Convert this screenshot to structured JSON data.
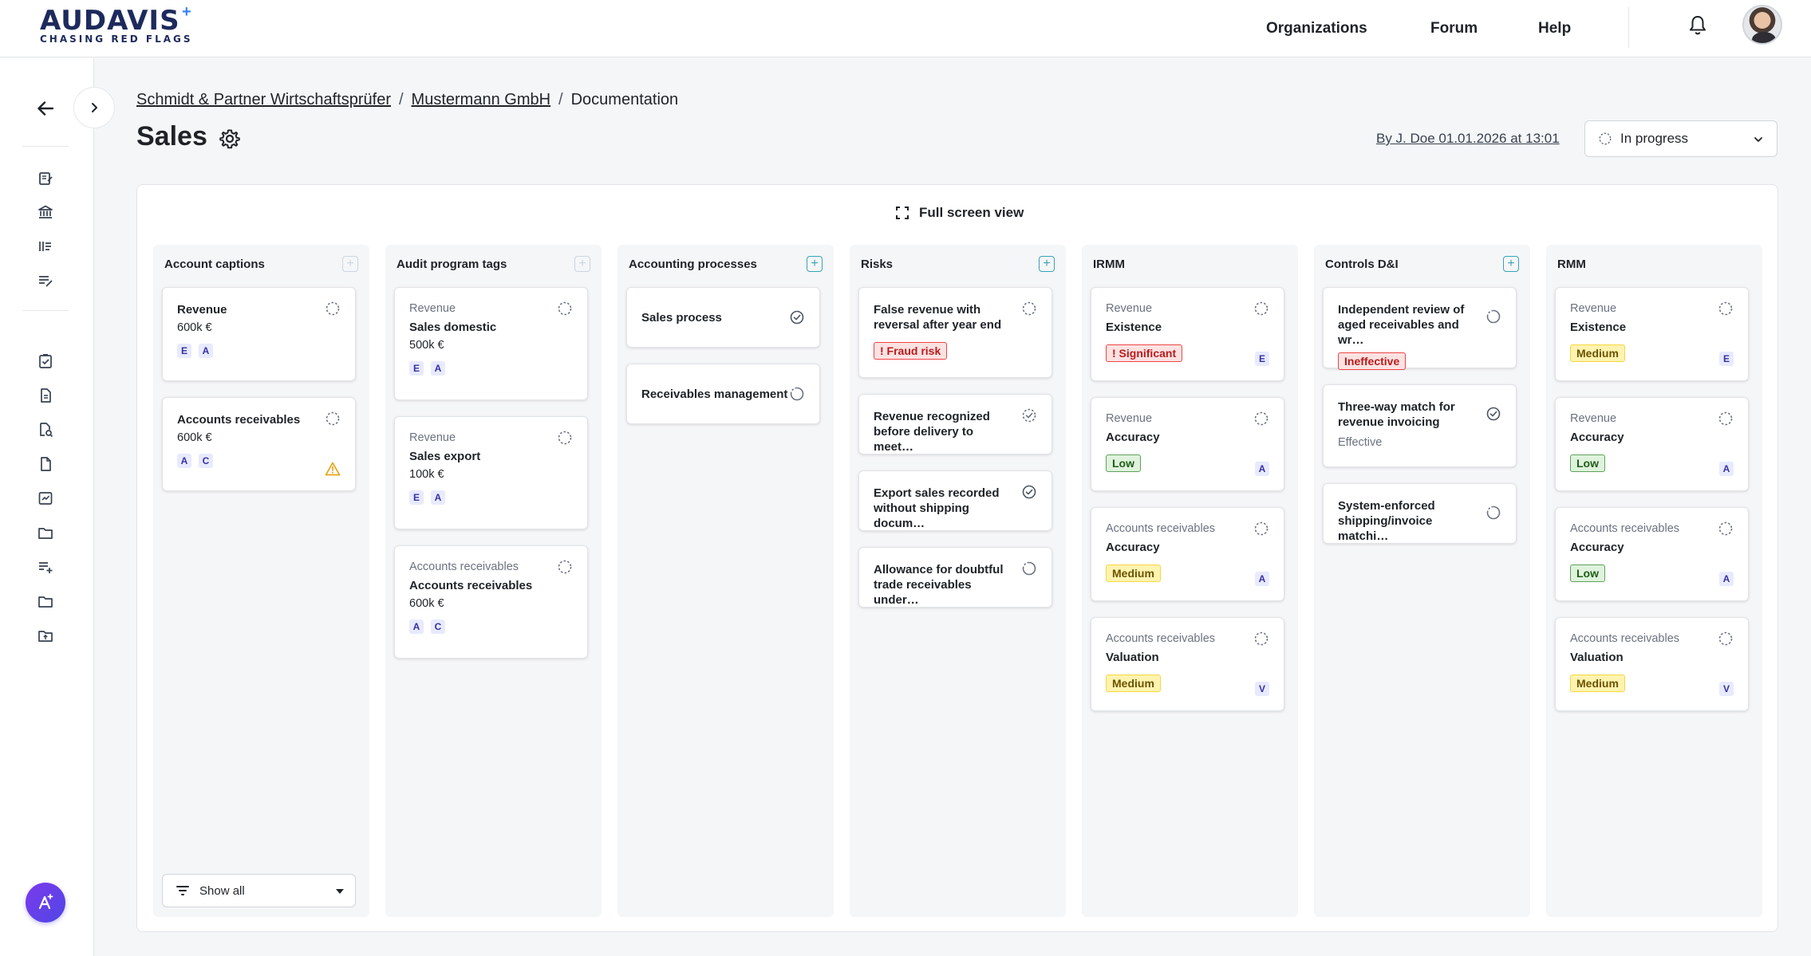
{
  "brand": {
    "name": "AUDAVIS",
    "star": "+",
    "tagline": "CHASING RED FLAGS"
  },
  "topnav": {
    "organizations": "Organizations",
    "forum": "Forum",
    "help": "Help"
  },
  "breadcrumb": {
    "firm": "Schmidt & Partner Wirtschaftsprüfer",
    "client": "Mustermann GmbH",
    "current": "Documentation",
    "separator": "/"
  },
  "page": {
    "title": "Sales",
    "byline": "By J. Doe 01.01.2026 at 13:01",
    "status": "In progress",
    "fullscreen_label": "Full screen view"
  },
  "columns": [
    {
      "title": "Account captions",
      "add_active": false,
      "cards": [
        {
          "title": "Revenue",
          "sub": "600k €",
          "tags": [
            "E",
            "A"
          ]
        },
        {
          "title": "Accounts receivables",
          "sub": "600k €",
          "tags": [
            "A",
            "C"
          ]
        }
      ],
      "filter_label": "Show all"
    },
    {
      "title": "Audit program tags",
      "add_active": false,
      "cards": [
        {
          "cap": "Revenue",
          "title": "Sales domestic",
          "sub": "500k €",
          "tags": [
            "E",
            "A"
          ]
        },
        {
          "cap": "Revenue",
          "title": "Sales export",
          "sub": "100k €",
          "tags": [
            "E",
            "A"
          ]
        },
        {
          "cap": "Accounts receivables",
          "title": "Accounts receivables",
          "sub": "600k €",
          "tags": [
            "A",
            "C"
          ]
        }
      ]
    },
    {
      "title": "Accounting processes",
      "add_active": true,
      "cards": [
        {
          "title": "Sales process"
        },
        {
          "title": "Receivables management"
        }
      ]
    },
    {
      "title": "Risks",
      "add_active": true,
      "cards": [
        {
          "title": "False revenue with reversal after year end",
          "badge": "! Fraud risk"
        },
        {
          "title": "Revenue recognized before delivery to meet…"
        },
        {
          "title": "Export sales recorded without shipping docum…"
        },
        {
          "title": "Allowance for doubtful trade receivables under…"
        }
      ]
    },
    {
      "title": "IRMM",
      "cards": [
        {
          "cap": "Revenue",
          "title": "Existence",
          "badge": "! Significant",
          "tag": "E"
        },
        {
          "cap": "Revenue",
          "title": "Accuracy",
          "badge": "Low",
          "tag": "A"
        },
        {
          "cap": "Accounts receivables",
          "title": "Accuracy",
          "badge": "Medium",
          "tag": "A"
        },
        {
          "cap": "Accounts receivables",
          "title": "Valuation",
          "badge": "Medium",
          "tag": "V"
        }
      ]
    },
    {
      "title": "Controls D&I",
      "add_active": true,
      "cards": [
        {
          "title": "Independent review of aged receivables and wr…",
          "badge": "Ineffective"
        },
        {
          "title": "Three-way match for revenue invoicing",
          "sub": "Effective"
        },
        {
          "title": "System-enforced shipping/invoice matchi…"
        }
      ]
    },
    {
      "title": "RMM",
      "cards": [
        {
          "cap": "Revenue",
          "title": "Existence",
          "badge": "Medium",
          "tag": "E"
        },
        {
          "cap": "Revenue",
          "title": "Accuracy",
          "badge": "Low",
          "tag": "A"
        },
        {
          "cap": "Accounts receivables",
          "title": "Accuracy",
          "badge": "Low",
          "tag": "A"
        },
        {
          "cap": "Accounts receivables",
          "title": "Valuation",
          "badge": "Medium",
          "tag": "V"
        }
      ]
    }
  ],
  "colors": {
    "accent": "#38a3b8",
    "brand": "#1d2a5c",
    "fraud": "#ef4444",
    "medium": "#f5d742",
    "low": "#5fa259",
    "tag_text": "#3730a3"
  },
  "icons": {
    "status": "status-circle-icon",
    "done": "check-circle-icon",
    "warning": "warning-triangle-icon",
    "settings": "gear-icon",
    "notifications": "bell-icon",
    "fullscreen": "expand-icon",
    "filter": "filter-icon",
    "assistant": "assistant-icon"
  }
}
